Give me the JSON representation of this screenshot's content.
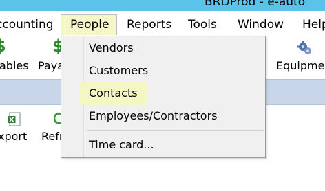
{
  "window": {
    "title": "BRDProd - e-auto"
  },
  "menubar": {
    "items": [
      {
        "label": "ccounting"
      },
      {
        "label": "People"
      },
      {
        "label": "Reports"
      },
      {
        "label": "Tools"
      },
      {
        "label": "Window"
      },
      {
        "label": "Help"
      }
    ],
    "active": "People"
  },
  "toolbar": {
    "buttons": [
      {
        "label": "ables",
        "icon": "dollar-icon"
      },
      {
        "label": "Paya",
        "icon": "dollar-icon"
      },
      {
        "label": "Equipme",
        "icon": "gear-icon"
      }
    ]
  },
  "toolbar2": {
    "buttons": [
      {
        "label": "xport",
        "icon": "excel-export-icon"
      },
      {
        "label": "Refr",
        "icon": "refresh-icon"
      }
    ]
  },
  "people_menu": {
    "items": [
      {
        "label": "Vendors"
      },
      {
        "label": "Customers"
      },
      {
        "label": "Contacts"
      },
      {
        "label": "Employees/Contractors"
      },
      {
        "label": "Time card..."
      }
    ],
    "highlighted": "Contacts",
    "highlight_color": "#f4f7c4"
  },
  "colors": {
    "titlebar": "#5bc3ea",
    "menu_active_bg": "#f6f7c8",
    "blue_band": "#c9d6ea",
    "dollar_green": "#2e8b2e"
  }
}
